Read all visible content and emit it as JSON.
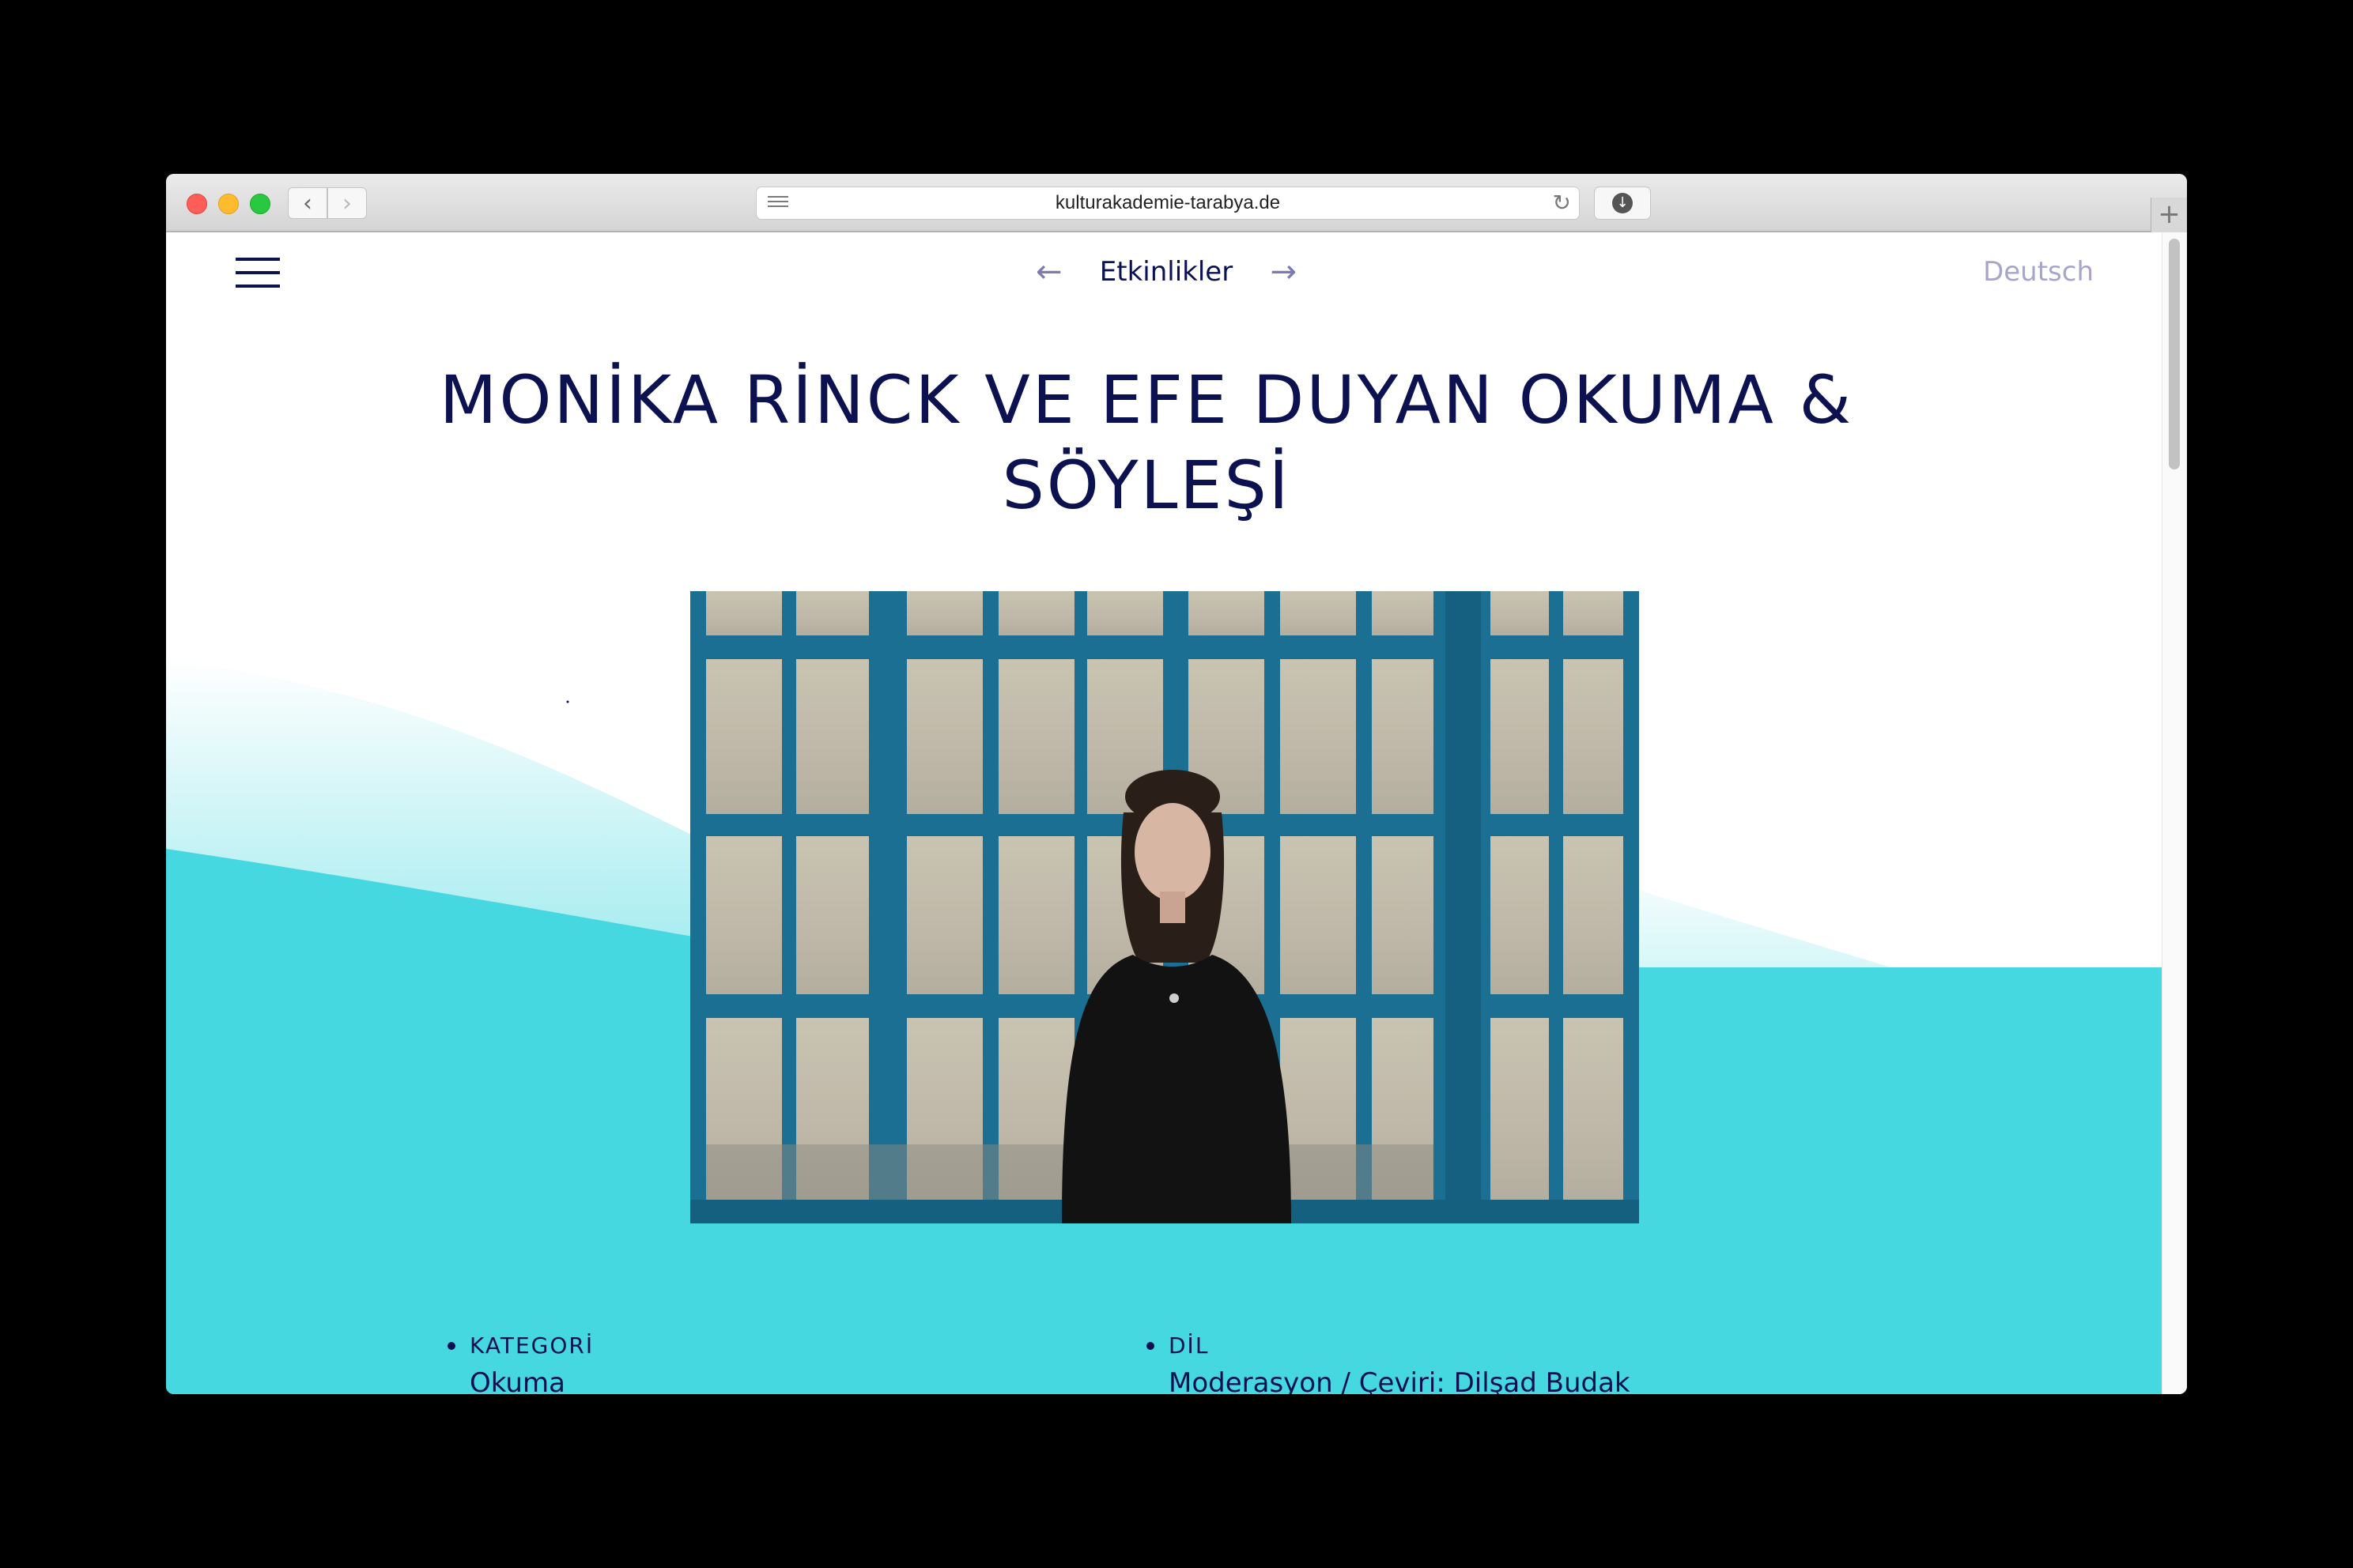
{
  "browser": {
    "url": "kulturakademie-tarabya.de"
  },
  "nav": {
    "section_title": "Etkinlikler",
    "prev_arrow": "←",
    "next_arrow": "→",
    "language_link": "Deutsch"
  },
  "page": {
    "title": "MONİKA RİNCK VE EFE DUYAN OKUMA & SÖYLEŞİ"
  },
  "details": [
    {
      "label": "KATEGORİ",
      "value": "Okuma"
    },
    {
      "label": "DİL",
      "value": "Moderasyon / Çeviri: Dilşad Budak"
    }
  ],
  "colors": {
    "accent_navy": "#0c1150",
    "turquoise": "#46d8e0",
    "muted_link": "#a7a5c8"
  },
  "icons": {
    "menu": "hamburger-icon",
    "reader": "reader-view-icon",
    "reload": "reload-icon",
    "download": "download-icon"
  }
}
